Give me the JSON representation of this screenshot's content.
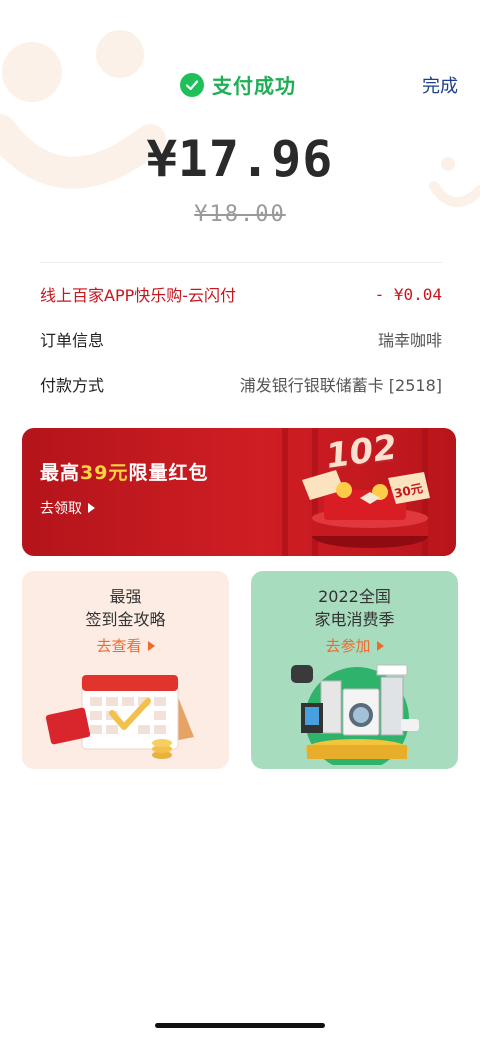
{
  "header": {
    "status_text": "支付成功",
    "done_label": "完成"
  },
  "payment": {
    "amount": "¥17.96",
    "original_amount": "¥18.00"
  },
  "details": {
    "promo_label": "线上百家APP快乐购-云闪付",
    "promo_value": "- ¥0.04",
    "order_label": "订单信息",
    "order_value": "瑞幸咖啡",
    "method_label": "付款方式",
    "method_value": "浦发银行银联储蓄卡 [2518]"
  },
  "banner": {
    "title_prefix": "最高",
    "title_highlight": "39元",
    "title_suffix": "限量红包",
    "cta": "去领取",
    "graphic_number": "102",
    "coupon_value": "30元"
  },
  "cards": [
    {
      "line1": "最强",
      "line2": "签到金攻略",
      "cta": "去查看"
    },
    {
      "line1": "2022全国",
      "line2": "家电消费季",
      "cta": "去参加"
    }
  ],
  "colors": {
    "success_green": "#1fae53",
    "done_blue": "#1e3f8a",
    "promo_red": "#c8161e",
    "banner_red": "#cf1e24",
    "highlight_yellow": "#ffd23f",
    "cta_orange": "#f06a2d",
    "card_left_bg": "#fdece4",
    "card_right_bg": "#a8dcbf"
  },
  "icons": {
    "status": "check-circle-icon",
    "cta_arrow": "triangle-right-icon"
  }
}
